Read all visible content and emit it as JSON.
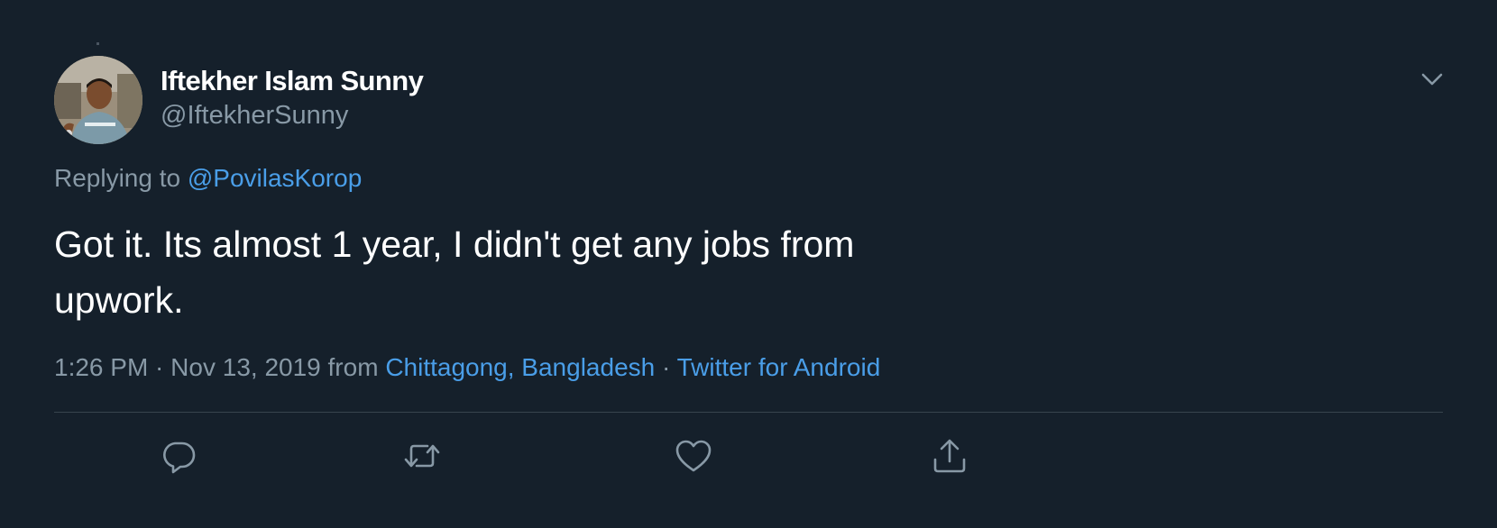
{
  "tweet": {
    "author": {
      "display_name": "Iftekher Islam Sunny",
      "handle": "@IftekherSunny"
    },
    "replying_prefix": "Replying to ",
    "replying_to": "@PovilasKorop",
    "text_line1": "Got it. Its almost 1 year, I didn't get any jobs from",
    "text_line2": "upwork.",
    "meta": {
      "time": "1:26 PM",
      "separator1": " · ",
      "date": "Nov 13, 2019",
      "from_prefix": " from ",
      "location": "Chittagong, Bangladesh",
      "separator2": " · ",
      "source": "Twitter for Android"
    },
    "actions": {
      "reply_icon": "reply-icon",
      "retweet_icon": "retweet-icon",
      "like_icon": "heart-icon",
      "share_icon": "share-icon"
    }
  },
  "colors": {
    "background": "#15202b",
    "text_primary": "#ffffff",
    "text_secondary": "#8899a6",
    "link": "#4a9ee8",
    "divider": "#38444d"
  }
}
